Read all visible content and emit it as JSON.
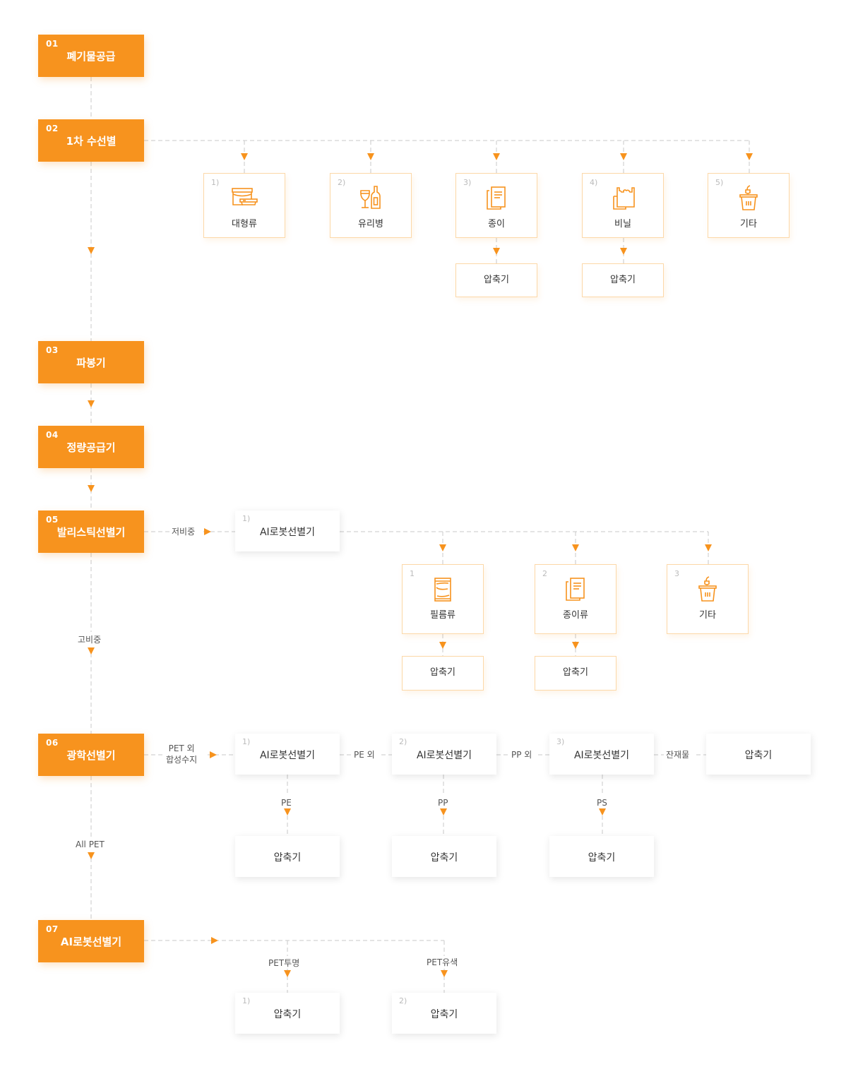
{
  "colors": {
    "accent": "#f7931e",
    "category_border": "#fcd8a8",
    "dash_line": "#c8c8c8",
    "index_text": "#bbbbbb"
  },
  "stages": [
    {
      "num": "01",
      "title": "폐기물공급"
    },
    {
      "num": "02",
      "title": "1차 수선별"
    },
    {
      "num": "03",
      "title": "파봉기"
    },
    {
      "num": "04",
      "title": "정량공급기"
    },
    {
      "num": "05",
      "title": "발리스틱선별기"
    },
    {
      "num": "06",
      "title": "광학선별기"
    },
    {
      "num": "07",
      "title": "AI로봇선별기"
    }
  ],
  "stage02": {
    "categories": [
      {
        "idx": "1)",
        "label": "대형류",
        "icon": "container-icon"
      },
      {
        "idx": "2)",
        "label": "유리병",
        "icon": "glass-bottle-icon"
      },
      {
        "idx": "3)",
        "label": "종이",
        "icon": "paper-icon"
      },
      {
        "idx": "4)",
        "label": "비닐",
        "icon": "plastic-bag-icon"
      },
      {
        "idx": "5)",
        "label": "기타",
        "icon": "trash-bin-icon"
      }
    ],
    "compressors": [
      {
        "label": "압축기",
        "parent": "종이"
      },
      {
        "label": "압축기",
        "parent": "비닐"
      }
    ]
  },
  "stage05": {
    "low_density_label": "저비중",
    "high_density_label": "고비중",
    "robot": {
      "idx": "1)",
      "label": "AI로봇선별기"
    },
    "categories": [
      {
        "idx": "1",
        "label": "필름류",
        "icon": "film-pack-icon"
      },
      {
        "idx": "2",
        "label": "종이류",
        "icon": "paper-icon"
      },
      {
        "idx": "3",
        "label": "기타",
        "icon": "trash-bin-icon"
      }
    ],
    "compressors": [
      {
        "label": "압축기",
        "parent": "필름류"
      },
      {
        "label": "압축기",
        "parent": "종이류"
      }
    ]
  },
  "stage06": {
    "input_label_line1": "PET 외",
    "input_label_line2": "합성수지",
    "all_pet_label": "All PET",
    "robots": [
      {
        "idx": "1)",
        "label": "AI로봇선별기",
        "output_label": "PE"
      },
      {
        "idx": "2)",
        "label": "AI로봇선별기",
        "output_label": "PP"
      },
      {
        "idx": "3)",
        "label": "AI로봇선별기",
        "output_label": "PS"
      }
    ],
    "chain_labels": [
      "PE 외",
      "PP 외",
      "잔재물"
    ],
    "residue_box": "압축기",
    "compressors": [
      "압축기",
      "압축기",
      "압축기"
    ]
  },
  "stage07": {
    "branches": [
      {
        "label": "PET투명",
        "idx": "1)",
        "box": "압축기"
      },
      {
        "label": "PET유색",
        "idx": "2)",
        "box": "압축기"
      }
    ]
  }
}
